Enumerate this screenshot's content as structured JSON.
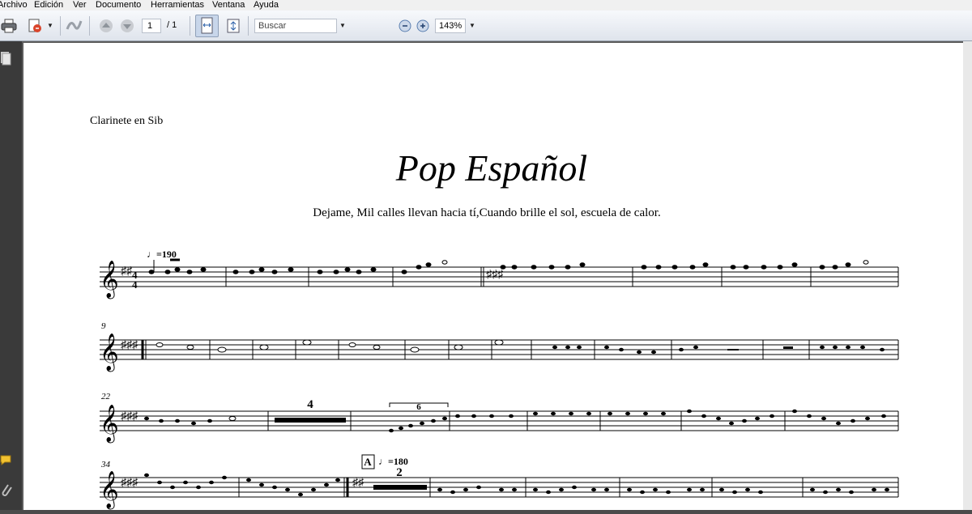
{
  "menu": [
    "Archivo",
    "Edición",
    "Ver",
    "Documento",
    "Herramientas",
    "Ventana",
    "Ayuda"
  ],
  "toolbar": {
    "page_current": "1",
    "page_total": "/ 1",
    "search_placeholder": "Buscar",
    "zoom": "143%",
    "icons": [
      "print-icon",
      "collaborate-icon",
      "sign-icon",
      "page-up-icon",
      "page-down-icon",
      "fit-width-icon",
      "fit-page-icon",
      "zoom-out-icon",
      "zoom-in-icon"
    ]
  },
  "document": {
    "instrument": "Clarinete en Sib",
    "title": "Pop Español",
    "subtitle": "Dejame, Mil calles llevan hacia tí,Cuando brille el sol, escuela de calor.",
    "tempo_1": "♩=190",
    "measure_9": "9",
    "measure_22": "22",
    "measure_34": "34",
    "rest_4": "4",
    "tuplet_6": "6",
    "rehearsal_A": "A",
    "tempo_2": "♩=180",
    "rest_2": "2"
  },
  "colors": {
    "accent": "#3b79c8",
    "menubar": "#f0f0f0",
    "sidebar": "#3a3a3a"
  }
}
